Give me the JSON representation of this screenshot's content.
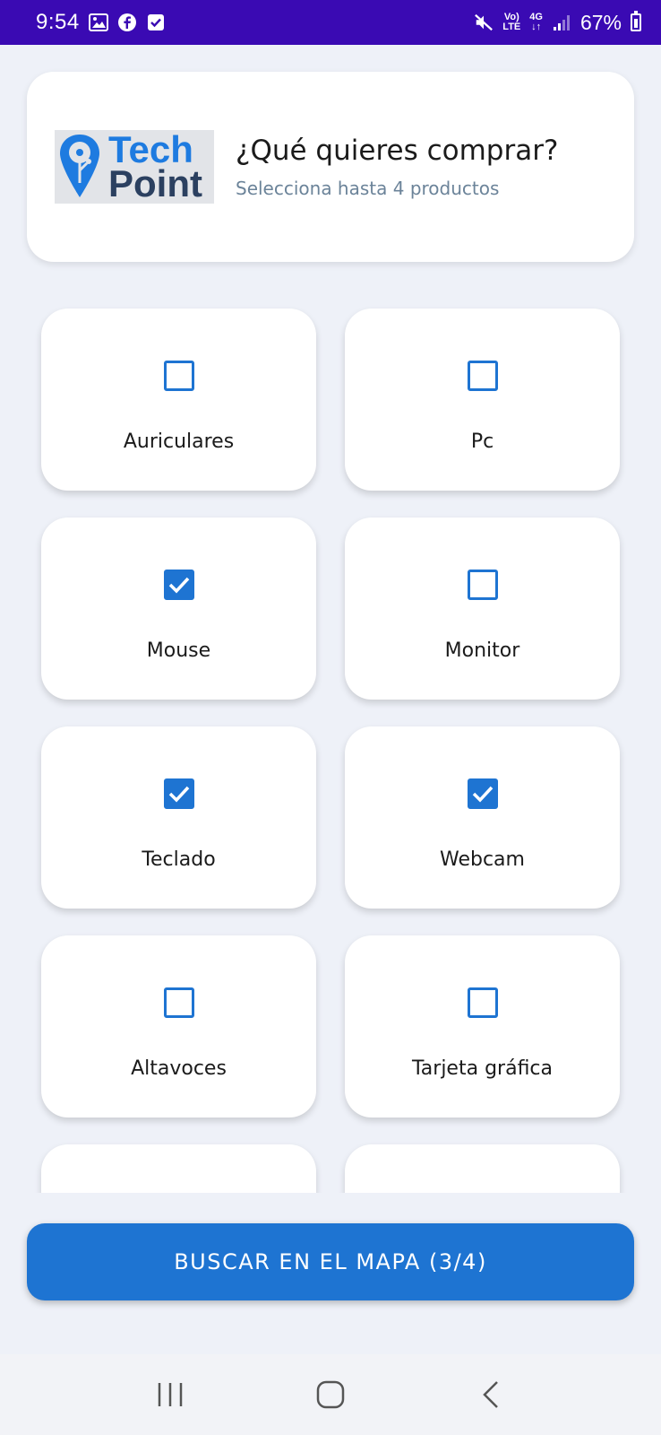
{
  "status_bar": {
    "time": "9:54",
    "icons_left": [
      "image-icon",
      "facebook-icon",
      "check-square-icon"
    ],
    "signal_text_top": "Vo)",
    "signal_text_bottom": "LTE",
    "network": "4G",
    "battery_percent": "67%"
  },
  "header": {
    "logo": {
      "line1": "Tech",
      "line2": "Point"
    },
    "title": "¿Qué quieres comprar?",
    "subtitle": "Selecciona hasta 4 productos"
  },
  "products": [
    {
      "label": "Auriculares",
      "checked": false
    },
    {
      "label": "Pc",
      "checked": false
    },
    {
      "label": "Mouse",
      "checked": true
    },
    {
      "label": "Monitor",
      "checked": false
    },
    {
      "label": "Teclado",
      "checked": true
    },
    {
      "label": "Webcam",
      "checked": true
    },
    {
      "label": "Altavoces",
      "checked": false
    },
    {
      "label": "Tarjeta gráfica",
      "checked": false
    },
    {
      "label": "",
      "checked": false
    },
    {
      "label": "",
      "checked": false
    }
  ],
  "search_button": {
    "label": "BUSCAR EN EL MAPA (3/4)"
  },
  "colors": {
    "accent": "#1e74d2",
    "status_bar": "#3a0ab3",
    "background": "#eef1f8",
    "logo_blue": "#1e7be0",
    "logo_dark": "#2b4060"
  }
}
